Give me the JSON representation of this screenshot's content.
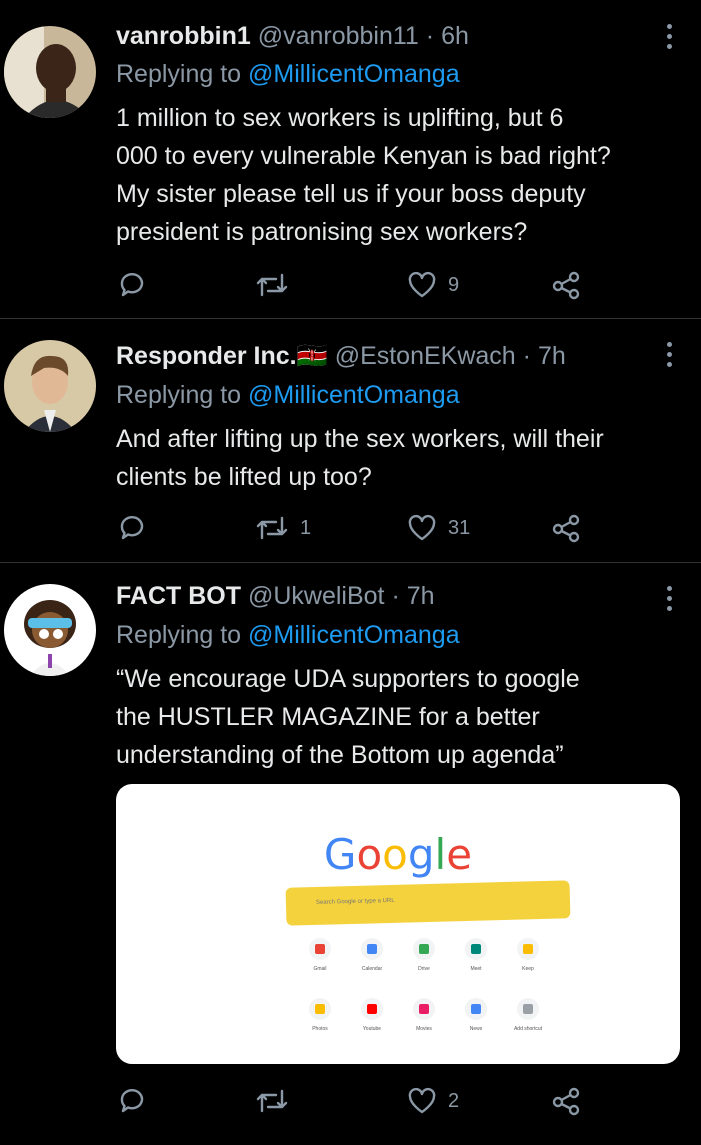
{
  "tweets": [
    {
      "name": "vanrobbin1",
      "flag": "",
      "handle": "@vanrobbin11",
      "time": "6h",
      "reply_prefix": "Replying to",
      "reply_to": "@MillicentOmanga",
      "text": [
        "1 million to sex workers is uplifting, but 6",
        "000 to every vulnerable Kenyan is bad right?",
        "My sister please tell us if your boss deputy",
        "president is patronising sex workers?"
      ],
      "retweets": "",
      "likes": "9"
    },
    {
      "name": "Responder Inc.",
      "flag": "🇰🇪",
      "handle": "@EstonEKwach",
      "time": "7h",
      "reply_prefix": "Replying to",
      "reply_to": "@MillicentOmanga",
      "text": [
        "And after lifting up the sex workers, will their",
        "clients be lifted up too?"
      ],
      "retweets": "1",
      "likes": "31"
    },
    {
      "name": "FACT BOT",
      "flag": "",
      "handle": "@UkweliBot",
      "time": "7h",
      "reply_prefix": "Replying to",
      "reply_to": "@MillicentOmanga",
      "text": [
        "“We encourage UDA supporters to google",
        "the HUSTLER MAGAZINE for a better",
        "understanding of the Bottom up agenda”"
      ],
      "retweets": "",
      "likes": "2"
    }
  ],
  "media": {
    "logo": [
      {
        "ch": "G",
        "color": "#4285f4"
      },
      {
        "ch": "o",
        "color": "#ea4335"
      },
      {
        "ch": "o",
        "color": "#fbbc05"
      },
      {
        "ch": "g",
        "color": "#4285f4"
      },
      {
        "ch": "l",
        "color": "#34a853"
      },
      {
        "ch": "e",
        "color": "#ea4335"
      }
    ],
    "search_placeholder": "Search Google or type a URL",
    "shortcuts": [
      {
        "label": "Gmail",
        "color": "#ea4335"
      },
      {
        "label": "Calendar",
        "color": "#4285f4"
      },
      {
        "label": "Drive",
        "color": "#34a853"
      },
      {
        "label": "Meet",
        "color": "#00897b"
      },
      {
        "label": "Keep",
        "color": "#fbbc05"
      },
      {
        "label": "Photos",
        "color": "#fbbc05"
      },
      {
        "label": "Youtube",
        "color": "#ff0000"
      },
      {
        "label": "Movies",
        "color": "#e91e63"
      },
      {
        "label": "News",
        "color": "#4285f4"
      },
      {
        "label": "Add shortcut",
        "color": "#9aa0a6"
      }
    ]
  }
}
